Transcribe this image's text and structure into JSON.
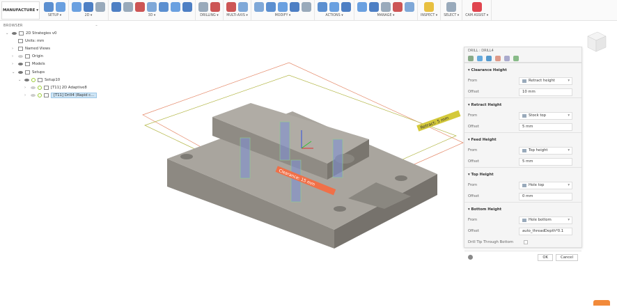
{
  "toolbar": {
    "workspace": "MANUFACTURE ▾",
    "groups": [
      {
        "label": "SETUP ▾",
        "icons": [
          "setup-icon",
          "setup-sheet-icon"
        ]
      },
      {
        "label": "2D ▾",
        "icons": [
          "2d-adaptive-icon",
          "2d-pocket-icon",
          "2d-contour-icon"
        ]
      },
      {
        "label": "3D ▾",
        "icons": [
          "3d-adaptive-icon",
          "3d-pocket-icon",
          "3d-parallel-icon",
          "3d-flow-icon",
          "3d-contour-icon",
          "3d-steep-shallow-icon",
          "3d-scallop-icon"
        ]
      },
      {
        "label": "DRILLING ▾",
        "icons": [
          "drill-icon",
          "hole-recognition-icon"
        ]
      },
      {
        "label": "MULTI-AXIS ▾",
        "icons": [
          "multi-axis-icon",
          "swarf-icon"
        ]
      },
      {
        "label": "MODIFY ▾",
        "icons": [
          "cut-icon",
          "delete-icon",
          "edit-icon",
          "modify-icon",
          "path-icon"
        ]
      },
      {
        "label": "ACTIONS ▾",
        "icons": [
          "simulate-icon",
          "post-process-icon",
          "setup-sheet-icon"
        ]
      },
      {
        "label": "MANAGE ▾",
        "icons": [
          "tool-library-icon",
          "template-icon",
          "machine-icon",
          "document-icon",
          "document-settings-icon"
        ]
      },
      {
        "label": "INSPECT ▾",
        "icons": [
          "measure-icon"
        ]
      },
      {
        "label": "SELECT ▾",
        "icons": [
          "select-icon"
        ]
      },
      {
        "label": "CAM ASSIST ▾",
        "icons": [
          "cam-assist-icon"
        ]
      }
    ]
  },
  "browser": {
    "title": "BROWSER",
    "items": [
      {
        "label": "2D Strategies v0",
        "depth": 0,
        "arrow": "⌄",
        "eye": true
      },
      {
        "label": "Units: mm",
        "depth": 1,
        "arrow": ""
      },
      {
        "label": "Named Views",
        "depth": 1,
        "arrow": "›"
      },
      {
        "label": "Origin",
        "depth": 1,
        "arrow": "›",
        "eye": false
      },
      {
        "label": "Models",
        "depth": 1,
        "arrow": "›",
        "eye": true
      },
      {
        "label": "Setups",
        "depth": 1,
        "arrow": "⌄",
        "eye": true
      },
      {
        "label": "Setup10",
        "depth": 2,
        "arrow": "⌄",
        "eye": true,
        "check": true
      },
      {
        "label": "[T11] 2D Adaptive8",
        "depth": 3,
        "arrow": "›",
        "eye": false,
        "check": true
      },
      {
        "label": "[T11] Drill4 (Rapid c...",
        "depth": 3,
        "arrow": "›",
        "eye": false,
        "check": true,
        "selected": true
      }
    ]
  },
  "viewport": {
    "retract_label": "Retract: 5 mm",
    "clearance_label": "Clearance: 15 mm",
    "colors": {
      "part": "#9e9a93",
      "clearance_plane": "#e58a6a",
      "retract_plane": "#b5b84a",
      "label_clearance": "#f07048",
      "label_retract": "#d4c93a"
    }
  },
  "panel": {
    "title": "DRILL : DRILL4",
    "tabs": [
      "tool-tab-icon",
      "geometry-tab-icon",
      "heights-tab-icon",
      "cycle-tab-icon",
      "passes-tab-icon",
      "linking-tab-icon"
    ],
    "sections": [
      {
        "title": "▾ Clearance Height",
        "from": "Retract height",
        "offset": "10 mm"
      },
      {
        "title": "▾ Retract Height",
        "from": "Stock top",
        "offset": "5 mm"
      },
      {
        "title": "▾ Feed Height",
        "from": "Top height",
        "offset": "5 mm"
      },
      {
        "title": "▾ Top Height",
        "from": "Hole top",
        "offset": "0 mm"
      },
      {
        "title": "▾ Bottom Height",
        "from": "Hole bottom",
        "offset": "auto_threadDepth*0.1"
      }
    ],
    "from_label": "From",
    "offset_label": "Offset",
    "drill_tip_label": "Drill Tip Through Bottom",
    "drill_tip_checked": false,
    "ok": "OK",
    "cancel": "Cancel"
  }
}
